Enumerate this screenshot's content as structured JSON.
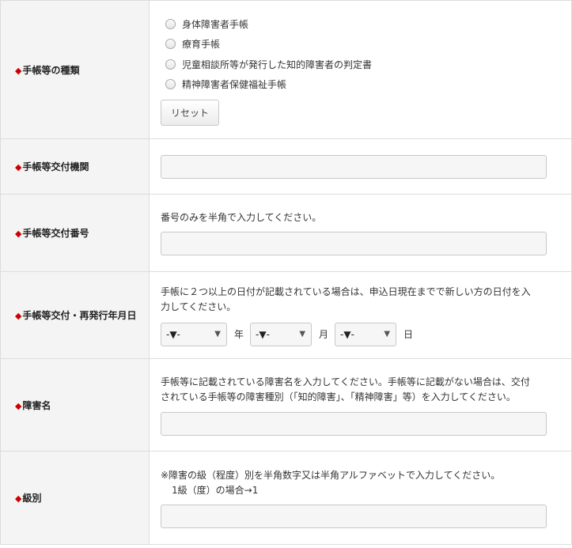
{
  "rows": {
    "type": {
      "label": "手帳等の種類",
      "options": [
        "身体障害者手帳",
        "療育手帳",
        "児童相談所等が発行した知的障害者の判定書",
        "精神障害者保健福祉手帳"
      ],
      "reset_label": "リセット"
    },
    "issuer": {
      "label": "手帳等交付機関"
    },
    "number": {
      "label": "手帳等交付番号",
      "hint": "番号のみを半角で入力してください。"
    },
    "date": {
      "label": "手帳等交付・再発行年月日",
      "hint_line1": "手帳に２つ以上の日付が記載されている場合は、申込日現在までで新しい方の日付を入",
      "hint_line2": "力してください。",
      "year_select": "-▼-",
      "month_select": "-▼-",
      "day_select": "-▼-",
      "year_unit": "年",
      "month_unit": "月",
      "day_unit": "日"
    },
    "disability": {
      "label": "障害名",
      "hint_line1": "手帳等に記載されている障害名を入力してください。手帳等に記載がない場合は、交付",
      "hint_line2": "されている手帳等の障害種別（「知的障害」、「精神障害」等）を入力してください。"
    },
    "grade": {
      "label": "級別",
      "hint_line1": "※障害の級（程度）別を半角数字又は半角アルファベットで入力してください。",
      "hint_line2": "1級（度）の場合→1"
    }
  },
  "marker": "◆",
  "colors": {
    "marker": "#cc0000",
    "label_bg": "#f4f4f4",
    "border": "#dcdcdc"
  }
}
